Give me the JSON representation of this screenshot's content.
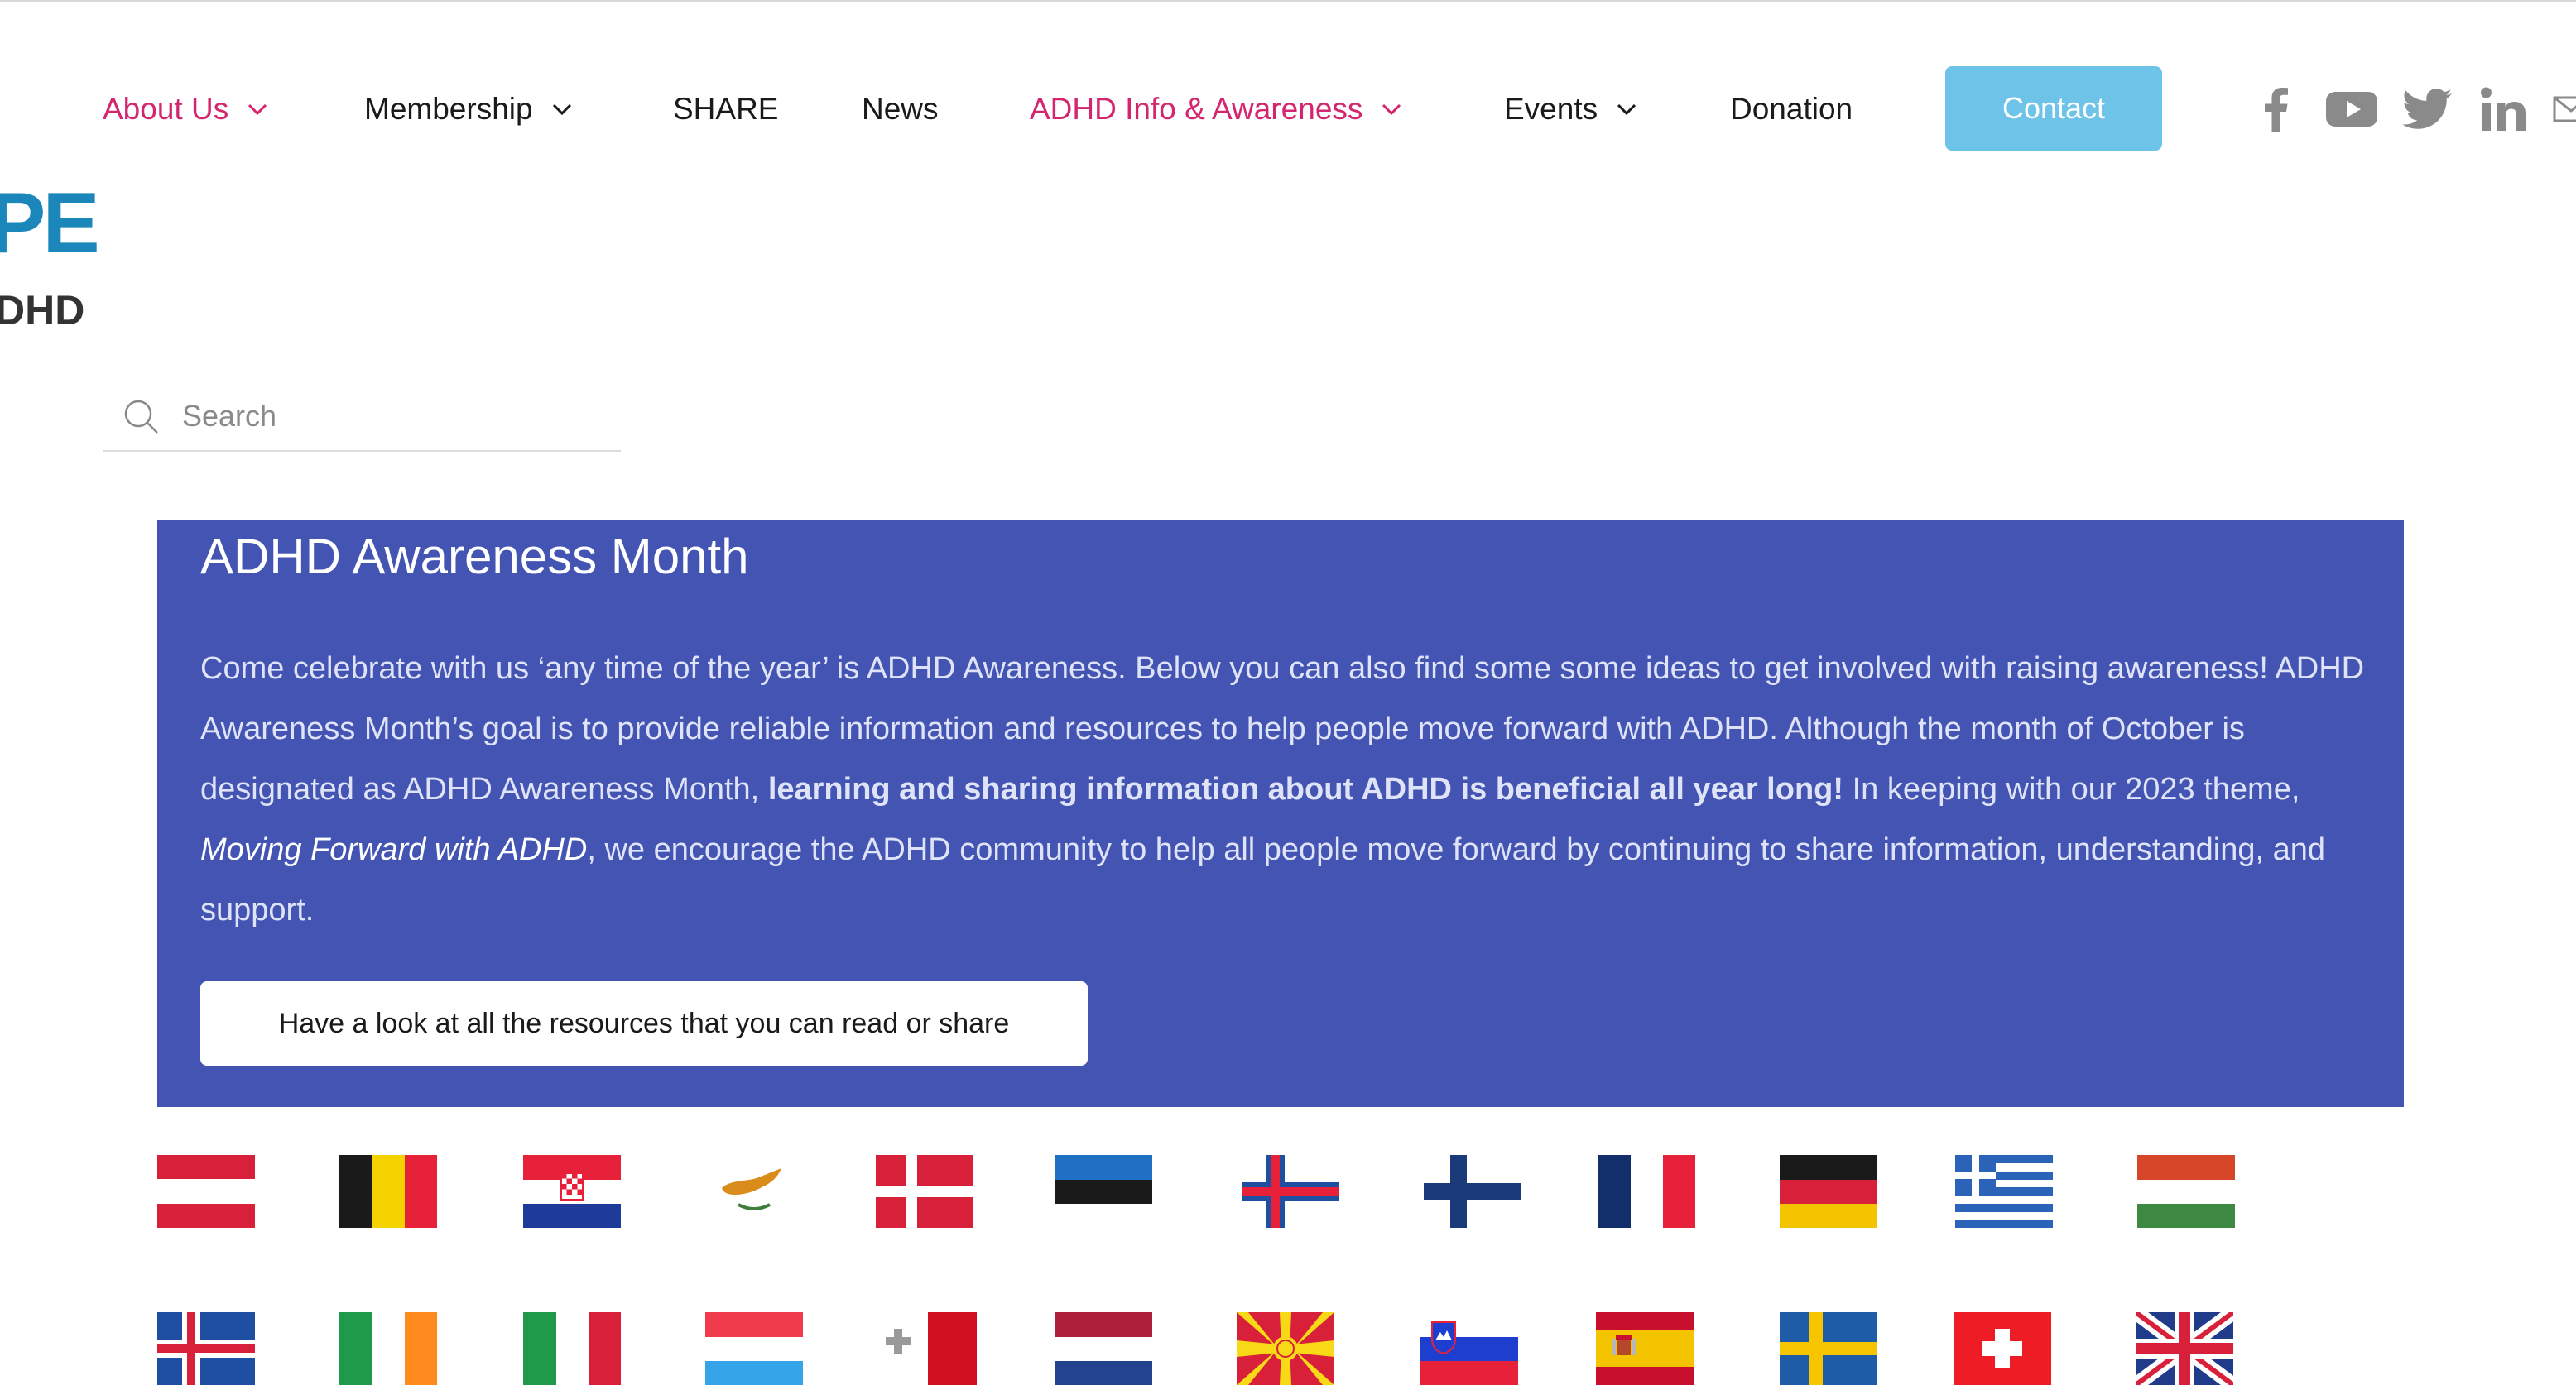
{
  "nav": {
    "items": [
      {
        "label": "About Us",
        "dropdown": true
      },
      {
        "label": "Membership",
        "dropdown": true
      },
      {
        "label": "SHARE",
        "dropdown": false
      },
      {
        "label": "News",
        "dropdown": false
      },
      {
        "label": "ADHD Info & Awareness",
        "dropdown": true
      },
      {
        "label": "Events",
        "dropdown": true
      },
      {
        "label": "Donation",
        "dropdown": false
      }
    ],
    "contact_label": "Contact",
    "social": [
      "facebook-icon",
      "youtube-icon",
      "twitter-icon",
      "linkedin-icon",
      "email-icon"
    ]
  },
  "logo": {
    "line1": "PE",
    "line2": "DHD"
  },
  "search": {
    "placeholder": "Search"
  },
  "banner": {
    "title": "ADHD Awareness Month",
    "text_1": "Come celebrate with us ‘any time of the year’ is ADHD Awareness. Below you can also find some  some ideas to get involved with raising awareness! ADHD Awareness Month’s goal is to provide reliable information and resources to help people move forward with ADHD. Although the month of October is designated as ADHD Awareness Month, ",
    "text_bold": "learning and sharing information about ADHD is beneficial all year long!",
    "text_2": " In keeping with our 2023 theme, ",
    "text_italic": "Moving Forward with ADHD",
    "text_3": ", we encourage the ADHD community to help all people move forward by continuing to share information, understanding, and support.",
    "button_label": "Have a look at all the resources that you can read or share"
  },
  "flags": {
    "row1": [
      "austria",
      "belgium",
      "croatia",
      "cyprus",
      "denmark",
      "estonia",
      "faroe-islands",
      "finland",
      "france",
      "germany",
      "greece",
      "hungary"
    ],
    "row2": [
      "iceland",
      "ireland",
      "italy",
      "luxembourg",
      "malta",
      "netherlands",
      "north-macedonia",
      "slovenia",
      "spain",
      "sweden",
      "switzerland",
      "united-kingdom"
    ]
  },
  "colors": {
    "accent_pink": "#d4266f",
    "contact_blue": "#6ec4e8",
    "banner_blue": "#4354b2",
    "logo_blue": "#1b86b9"
  }
}
